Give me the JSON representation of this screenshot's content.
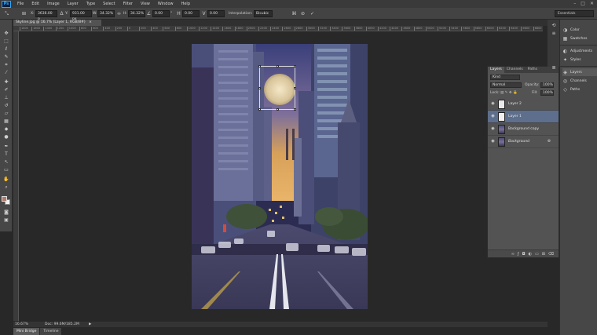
{
  "app": {
    "logo": "Ps"
  },
  "menu": [
    "File",
    "Edit",
    "Image",
    "Layer",
    "Type",
    "Select",
    "Filter",
    "View",
    "Window",
    "Help"
  ],
  "window_controls": {
    "minimize": "–",
    "maximize": "□",
    "close": "✕"
  },
  "options": {
    "x_value": "3636.00 p",
    "y_value": "931.00 px",
    "w_value": "34.32%",
    "h_value": "34.32%",
    "angle_value": "0.00",
    "h_skew": "0.00",
    "v_skew": "0.00",
    "interpolation_label": "Interpolation:",
    "interpolation_value": "Bicubic",
    "essentials": "Essentials"
  },
  "document": {
    "tab_title": "Skyline.jpg @ 16.7% (Layer 1, RGB/8#)",
    "close": "×"
  },
  "ruler_ticks": [
    "1800",
    "1600",
    "1400",
    "1200",
    "1000",
    "800",
    "600",
    "400",
    "200",
    "0",
    "200",
    "400",
    "600",
    "800",
    "1000",
    "1200",
    "1400",
    "1600",
    "1800",
    "2000",
    "2200",
    "2400",
    "2600",
    "2800",
    "3000",
    "3200",
    "3400",
    "3600",
    "3800",
    "4000",
    "4200",
    "4400",
    "4600",
    "4800",
    "5000",
    "5200",
    "5400",
    "5600",
    "5800",
    "6000",
    "6200",
    "6400",
    "6600",
    "6800"
  ],
  "status": {
    "zoom": "16.67%",
    "doc": "Doc: 99.6M/185.2M"
  },
  "bottom_tabs": [
    "Mini Bridge",
    "Timeline"
  ],
  "layers_panel": {
    "tabs": [
      "Layers",
      "Channels",
      "Paths"
    ],
    "kind": "Kind",
    "blend_mode": "Normal",
    "opacity_label": "Opacity:",
    "opacity_value": "100%",
    "lock_label": "Lock:",
    "fill_label": "Fill:",
    "fill_value": "100%",
    "layers": [
      {
        "name": "Layer 2"
      },
      {
        "name": "Layer 1"
      },
      {
        "name": "Background copy"
      },
      {
        "name": "Background"
      }
    ]
  },
  "dock": {
    "items": [
      "Color",
      "Swatches",
      "Adjustments",
      "Styles",
      "Layers",
      "Channels",
      "Paths"
    ]
  },
  "colors": {
    "accent": "#31a8ff",
    "selected_layer": "#5d6f8c",
    "foreground_swatch": "#b07a6a",
    "background_swatch": "#f2f2f2"
  },
  "icons": {
    "tools": [
      "move-icon",
      "marquee-icon",
      "lasso-icon",
      "quick-select-icon",
      "crop-icon",
      "eyedropper-icon",
      "healing-icon",
      "brush-icon",
      "stamp-icon",
      "history-brush-icon",
      "eraser-icon",
      "gradient-icon",
      "blur-icon",
      "dodge-icon",
      "pen-icon",
      "type-icon",
      "path-select-icon",
      "shape-icon",
      "hand-icon",
      "zoom-icon"
    ]
  }
}
